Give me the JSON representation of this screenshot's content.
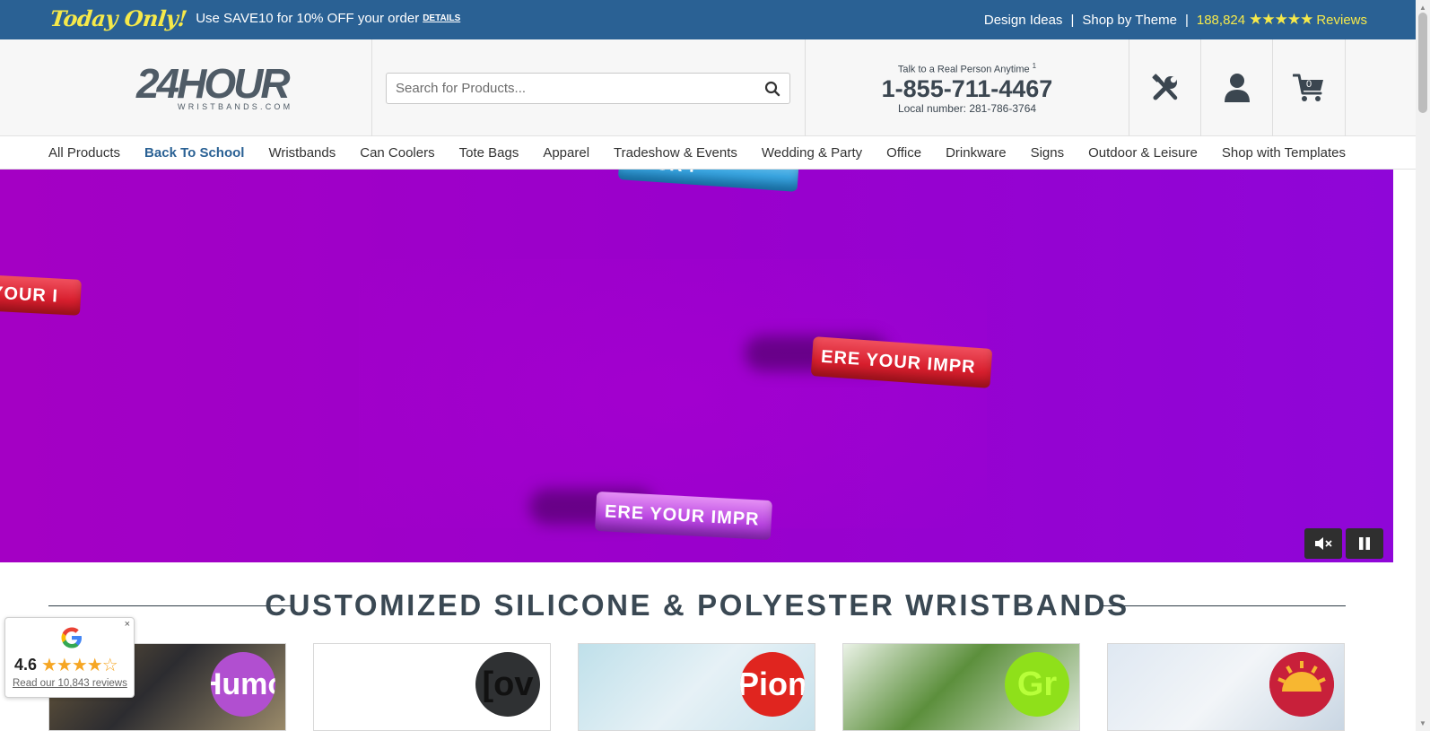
{
  "promo": {
    "today_only": "Today Only!",
    "text": "Use SAVE10 for 10% OFF your order",
    "details": "DETAILS",
    "design_ideas": "Design Ideas",
    "separator": "|",
    "shop_by_theme": "Shop by Theme",
    "review_count": "188,824",
    "stars": "★★★★★",
    "reviews": "Reviews"
  },
  "header": {
    "logo_main": "24HOUR",
    "logo_sub": "WRISTBANDS.COM",
    "search_placeholder": "Search for Products...",
    "contact_tag": "Talk to a Real Person Anytime",
    "contact_sup": "1",
    "phone": "1-855-711-4467",
    "local": "Local number: 281-786-3764",
    "cart_count": "0"
  },
  "nav": {
    "items": [
      "All Products",
      "Back To School",
      "Wristbands",
      "Can Coolers",
      "Tote Bags",
      "Apparel",
      "Tradeshow & Events",
      "Wedding & Party",
      "Office",
      "Drinkware",
      "Signs",
      "Outdoor & Leisure",
      "Shop with Templates"
    ]
  },
  "hero": {
    "band_1": "YOUR I",
    "band_2": "YOUR IMP",
    "band_3": "ERE   YOUR IMPR",
    "band_4": "ERE   YOUR IMPR"
  },
  "section": {
    "heading": "CUSTOMIZED SILICONE & POLYESTER WRISTBANDS"
  },
  "products": {
    "card_1": "Humo",
    "card_2": "[ov",
    "card_3": "Pion",
    "card_4": "Gr",
    "card_5": ""
  },
  "google_badge": {
    "close": "×",
    "rating": "4.6",
    "stars": "★★★★☆",
    "link": "Read our 10,843 reviews"
  },
  "colors": {
    "promo_bg": "#2a6194",
    "accent_yellow": "#f6e94a",
    "hero_purple": "#9a00cc",
    "nav_active": "#2a6194"
  }
}
